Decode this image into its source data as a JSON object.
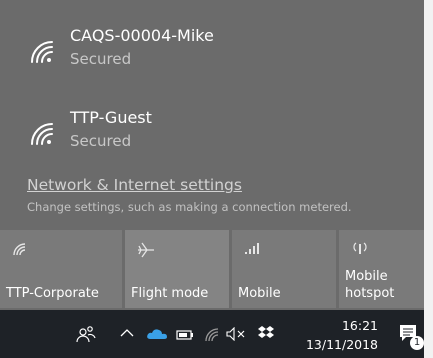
{
  "networks": [
    {
      "name": "CAQS-00004-Mike",
      "status": "Secured",
      "icon": "wifi-secured-icon"
    },
    {
      "name": "TTP-Guest",
      "status": "Secured",
      "icon": "wifi-secured-icon"
    }
  ],
  "settings": {
    "link": "Network & Internet settings",
    "description": "Change settings, such as making a connection metered."
  },
  "quick_actions": [
    {
      "label": "TTP-Corporate",
      "icon": "wifi-icon",
      "active": false
    },
    {
      "label": "Flight mode",
      "icon": "airplane-icon",
      "active": true
    },
    {
      "label": "Mobile",
      "icon": "cellular-icon",
      "active": false
    },
    {
      "label": "Mobile\nhotspot",
      "line1": "Mobile",
      "line2": "hotspot",
      "icon": "hotspot-icon",
      "active": false
    }
  ],
  "taskbar": {
    "time": "16:21",
    "date": "13/11/2018",
    "notification_count": "1",
    "icons": [
      "people-icon",
      "chevron-up-icon",
      "onedrive-icon",
      "battery-icon",
      "wifi-icon",
      "volume-muted-icon",
      "dropbox-icon",
      "action-center-icon"
    ]
  },
  "colors": {
    "flyout_bg": "#6b6b6b",
    "tile_bg": "#7a7a7a",
    "taskbar_bg": "#1e2227",
    "onedrive": "#3aa0e6"
  }
}
